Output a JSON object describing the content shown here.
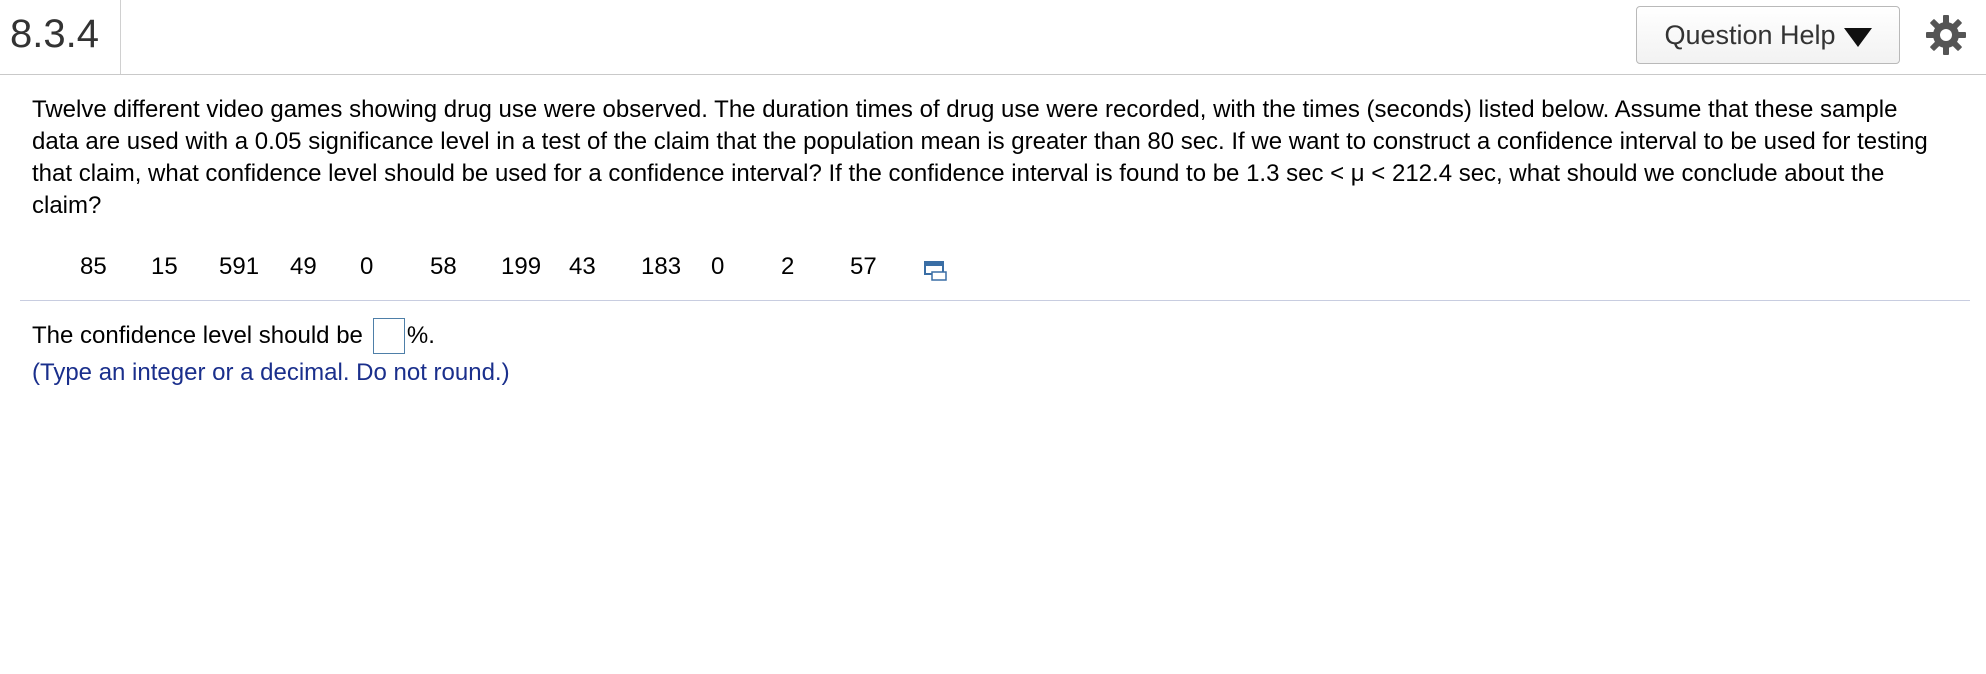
{
  "header": {
    "question_number": "8.3.4",
    "help_label": "Question Help"
  },
  "icons": {
    "help_caret": "triangle-down-icon",
    "settings": "gear-icon",
    "data_table": "data-table-icon"
  },
  "problem": {
    "text": "Twelve different video games showing drug use were observed. The duration times of drug use were recorded, with the times (seconds) listed below. Assume that these sample data are used with a 0.05 significance level in a test of the claim that the population mean is greater than 80 sec. If we want to construct a confidence interval to be used for testing that claim, what confidence level should be used for a confidence interval? If the confidence interval is found to be 1.3 sec < μ < 212.4 sec, what should we conclude about the claim?"
  },
  "data_values": [
    "85",
    "15",
    "591",
    "49",
    "0",
    "58",
    "199",
    "43",
    "183",
    "0",
    "2",
    "57"
  ],
  "answer": {
    "prefix": "The confidence level should be",
    "value": "",
    "suffix": "%.",
    "hint": "(Type an integer or a decimal. Do not round.)"
  },
  "colors": {
    "hint_text": "#1a2f8c",
    "input_border": "#4e7fa8",
    "data_icon": "#3a6ea5"
  }
}
